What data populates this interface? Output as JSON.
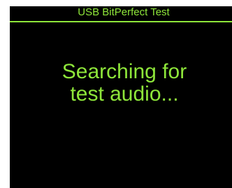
{
  "screen": {
    "title": "USB BitPerfect Test",
    "status_line_1": "Searching for",
    "status_line_2": "test audio..."
  },
  "colors": {
    "background": "#000000",
    "foreground": "#8ee63a"
  }
}
